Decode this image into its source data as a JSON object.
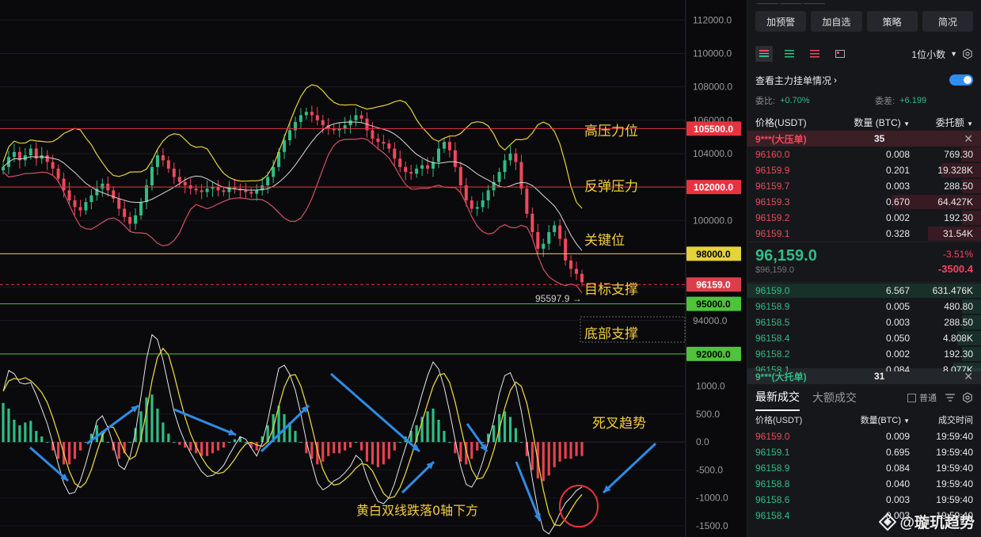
{
  "right_panel": {
    "top_strip": "———  ———  ———",
    "buttons": [
      "加预警",
      "加自选",
      "策略",
      "简况"
    ],
    "decimal_label": "1位小数",
    "main_orders_label": "查看主力挂单情况",
    "commission_ratio_label": "委比:",
    "commission_ratio_value": "+0.70%",
    "commission_diff_label": "委差:",
    "commission_diff_value": "+6.199",
    "col_price": "价格(USDT)",
    "col_qty": "数量 (BTC)",
    "col_amount": "委托额",
    "big_sell_label": "9***(大压单)",
    "big_sell_count": "35",
    "asks": [
      {
        "price": "96160.0",
        "qty": "0.008",
        "amount": "769.30"
      },
      {
        "price": "96159.9",
        "qty": "0.201",
        "amount": "19.328K"
      },
      {
        "price": "96159.7",
        "qty": "0.003",
        "amount": "288.50"
      },
      {
        "price": "96159.3",
        "qty": "0.670",
        "amount": "64.427K"
      },
      {
        "price": "96159.2",
        "qty": "0.002",
        "amount": "192.30"
      },
      {
        "price": "96159.1",
        "qty": "0.328",
        "amount": "31.54K"
      }
    ],
    "last_price": "96,159.0",
    "last_price_usd": "$96,159.0",
    "change_pct": "-3.51%",
    "change_abs": "-3500.4",
    "bids": [
      {
        "price": "96159.0",
        "qty": "6.567",
        "amount": "631.476K"
      },
      {
        "price": "96158.9",
        "qty": "0.005",
        "amount": "480.80"
      },
      {
        "price": "96158.5",
        "qty": "0.003",
        "amount": "288.50"
      },
      {
        "price": "96158.4",
        "qty": "0.050",
        "amount": "4.808K"
      },
      {
        "price": "96158.2",
        "qty": "0.002",
        "amount": "192.30"
      },
      {
        "price": "96158.1",
        "qty": "0.084",
        "amount": "8.077K"
      }
    ],
    "big_buy_label": "9***(大托单)",
    "big_buy_count": "31",
    "tab_latest": "最新成交",
    "tab_large": "大额成交",
    "normal_label": "普通",
    "trade_col_price": "价格(USDT)",
    "trade_col_qty": "数量(BTC)",
    "trade_col_time": "成交时间",
    "trades": [
      {
        "price": "96159.0",
        "qty": "0.009",
        "time": "19:59:40",
        "side": "sell"
      },
      {
        "price": "96159.1",
        "qty": "0.695",
        "time": "19:59:40",
        "side": "buy"
      },
      {
        "price": "96158.9",
        "qty": "0.084",
        "time": "19:59:40",
        "side": "buy"
      },
      {
        "price": "96158.8",
        "qty": "0.040",
        "time": "19:59:40",
        "side": "buy"
      },
      {
        "price": "96158.6",
        "qty": "0.003",
        "time": "19:59:40",
        "side": "buy"
      },
      {
        "price": "96158.4",
        "qty": "0.003",
        "time": "19:59:40",
        "side": "buy"
      }
    ],
    "watermark": "@璇玑趋势"
  },
  "chart_data": {
    "type": "candlestick",
    "price_axis_ticks": [
      112000,
      110000,
      108000,
      106000,
      104000,
      102000,
      100000,
      98000,
      96000,
      94000,
      92000
    ],
    "price_range": [
      91000,
      113200
    ],
    "levels": [
      {
        "value": 105500,
        "tag": "105500.0",
        "note": "高压力位",
        "color": "#e8333f",
        "tag_bg": "#e8333f"
      },
      {
        "value": 102000,
        "tag": "102000.0",
        "note": "反弹压力",
        "color": "#e8333f",
        "tag_bg": "#e8333f"
      },
      {
        "value": 98000,
        "tag": "98000.0",
        "note": "关键位",
        "color": "#e6d23a",
        "tag_bg": "#e6d23a"
      },
      {
        "value": 96159,
        "tag": "96159.0",
        "note": "目标支撑",
        "color": "#e8333f",
        "tag_bg": "#d93f4b"
      },
      {
        "value": 95000,
        "tag": "95000.0",
        "note": "",
        "color": "#4fc33a",
        "tag_bg": "#4fc33a"
      },
      {
        "value": 92000,
        "tag": "92000.0",
        "note": "底部支撑",
        "color": "#4fc33a",
        "tag_bg": "#4fc33a"
      }
    ],
    "low_marker": "95597.9",
    "low_marker_value": 95597.9,
    "macd_ticks": [
      1000,
      500,
      0,
      -500,
      -1000,
      -1500
    ],
    "macd_range": [
      -1700,
      1250
    ],
    "annotation_dead_cross": "死叉趋势",
    "annotation_lines": "黄白双线跌落0轴下方",
    "closes": [
      103200,
      103800,
      104100,
      103600,
      103900,
      104300,
      103700,
      103900,
      103500,
      103100,
      102500,
      101800,
      101200,
      100800,
      100600,
      101100,
      101500,
      101900,
      102200,
      101800,
      101300,
      100700,
      100200,
      99800,
      100300,
      101100,
      102100,
      103200,
      103900,
      103600,
      103100,
      102600,
      102300,
      102100,
      101900,
      101800,
      101700,
      101900,
      102000,
      101800,
      101700,
      102000,
      101900,
      101800,
      101700,
      101600,
      101800,
      102100,
      102600,
      103200,
      104100,
      104800,
      105400,
      105900,
      106300,
      106500,
      106300,
      106000,
      105700,
      105500,
      105400,
      105500,
      105700,
      106000,
      106300,
      106100,
      105400,
      104900,
      104700,
      104600,
      104300,
      103700,
      103200,
      102900,
      102800,
      103100,
      103300,
      103100,
      103500,
      104300,
      104700,
      104200,
      103200,
      102100,
      101200,
      100700,
      100800,
      101200,
      101800,
      102300,
      102900,
      103600,
      104000,
      103500,
      101900,
      100400,
      99300,
      98300,
      98600,
      99300,
      99700,
      98900,
      97600,
      97100,
      96800,
      96300
    ],
    "macd_hist": [
      700,
      600,
      400,
      300,
      350,
      380,
      200,
      100,
      0,
      -150,
      -300,
      -400,
      -400,
      -300,
      -150,
      0,
      150,
      300,
      200,
      0,
      -150,
      -300,
      -200,
      0,
      250,
      550,
      800,
      850,
      600,
      350,
      150,
      0,
      -50,
      -100,
      -150,
      -200,
      -250,
      -250,
      -200,
      -150,
      -100,
      0,
      50,
      100,
      0,
      -100,
      -150,
      100,
      300,
      500,
      650,
      500,
      350,
      200,
      0,
      -200,
      -300,
      -400,
      -350,
      -250,
      -200,
      -200,
      -150,
      -100,
      0,
      -150,
      -350,
      -400,
      -450,
      -400,
      -300,
      -150,
      0,
      100,
      200,
      300,
      450,
      550,
      600,
      400,
      200,
      0,
      -200,
      -350,
      -400,
      -300,
      -150,
      0,
      150,
      300,
      500,
      550,
      450,
      250,
      0,
      -250,
      -500,
      -650,
      -700,
      -600,
      -450,
      -350,
      -300,
      -300,
      -250,
      -250
    ]
  }
}
